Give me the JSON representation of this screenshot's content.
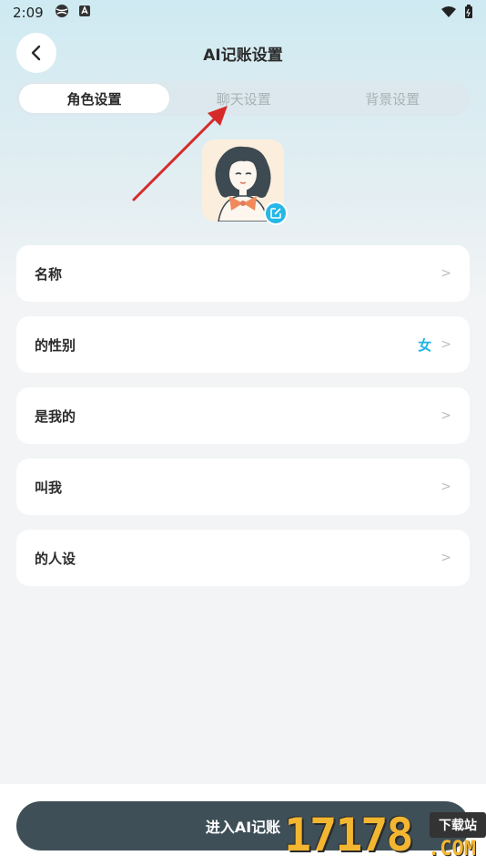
{
  "status_bar": {
    "time": "2:09"
  },
  "header": {
    "title": "AI记账设置"
  },
  "tabs": [
    {
      "label": "角色设置",
      "active": true
    },
    {
      "label": "聊天设置",
      "active": false
    },
    {
      "label": "背景设置",
      "active": false
    }
  ],
  "settings": [
    {
      "label": "名称",
      "value": ""
    },
    {
      "label": "的性别",
      "value": "女"
    },
    {
      "label": "是我的",
      "value": ""
    },
    {
      "label": "叫我",
      "value": ""
    },
    {
      "label": "的人设",
      "value": ""
    }
  ],
  "footer": {
    "enter_button": "进入AI记账"
  },
  "watermark": {
    "number": "17178",
    "suffix": ".COM",
    "badge": "下载站"
  },
  "colors": {
    "accent": "#1fb3e5",
    "button_bg": "#3f4f58",
    "annotation_arrow": "#d62a2a"
  }
}
